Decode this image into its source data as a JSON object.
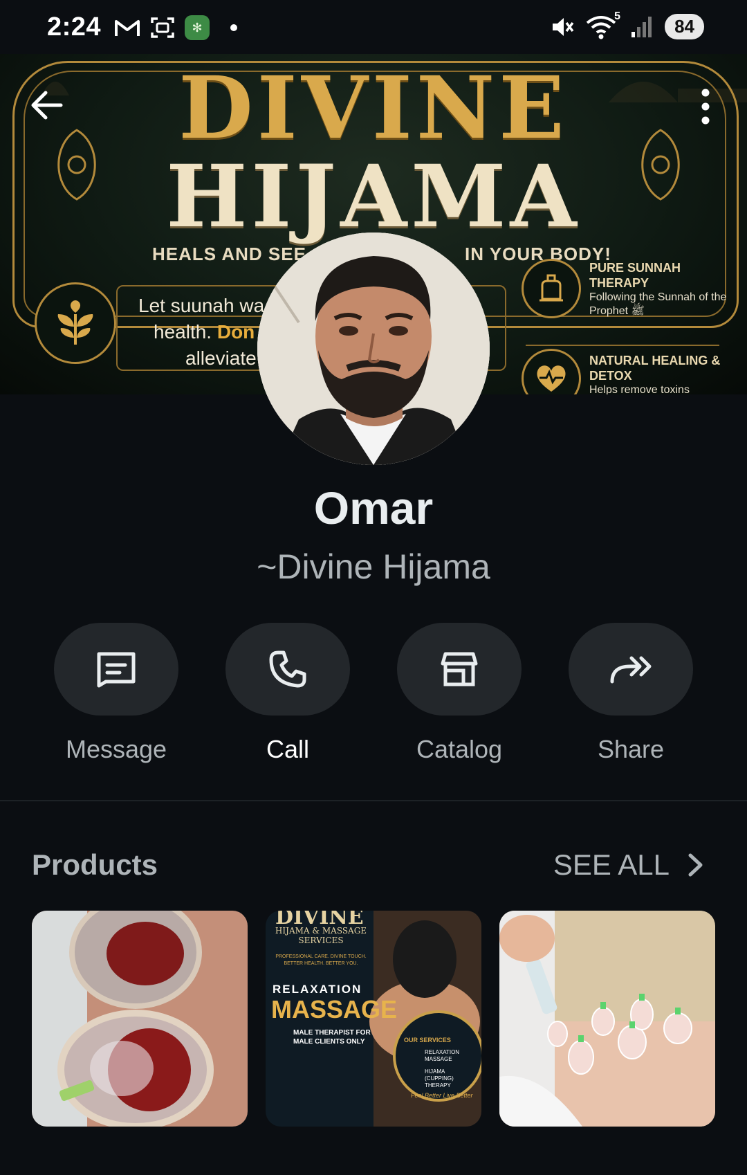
{
  "status_bar": {
    "time": "2:24",
    "battery": "84",
    "network_badge": "5",
    "icons": [
      "gmail-icon",
      "screenshot-icon",
      "quran-app-icon",
      "notification-dot",
      "mute-icon",
      "wifi-icon",
      "signal-icon",
      "battery-icon"
    ]
  },
  "cover": {
    "title_line1": "DIVINE",
    "title_line2": "HIJAMA",
    "tagline_left": "HEALS AND SEE",
    "tagline_right": "IN YOUR BODY!",
    "promo_line1": "Let suunah wa",
    "promo_line2_plain": "health. ",
    "promo_line2_bold": "Don",
    "promo_line3": "alleviate",
    "feature1_title": "PURE SUNNAH THERAPY",
    "feature1_desc": "Following the Sunnah of the Prophet ﷺ",
    "feature2_title": "NATURAL HEALING & DETOX",
    "feature2_desc": "Helps remove toxins"
  },
  "profile": {
    "name": "Omar",
    "subtitle": "~Divine Hijama"
  },
  "actions": [
    {
      "label": "Message",
      "icon": "message-icon"
    },
    {
      "label": "Call",
      "icon": "phone-icon"
    },
    {
      "label": "Catalog",
      "icon": "storefront-icon"
    },
    {
      "label": "Share",
      "icon": "share-forward-icon"
    }
  ],
  "products": {
    "title": "Products",
    "see_all": "SEE ALL",
    "items": [
      {
        "name": "cupping-closeup"
      },
      {
        "name": "massage-flyer",
        "flyer_title": "DIVINE",
        "flyer_subtitle": "HIJAMA & MASSAGE SERVICES",
        "flyer_tagline": "PROFESSIONAL CARE. DIVINE TOUCH. BETTER HEALTH. BETTER YOU.",
        "flyer_heading1": "RELAXATION",
        "flyer_heading2": "MASSAGE",
        "flyer_badge": "MALE THERAPIST FOR MALE CLIENTS ONLY",
        "flyer_services": "OUR SERVICES",
        "flyer_service1": "RELAXATION MASSAGE",
        "flyer_service2": "HIJAMA (CUPPING) THERAPY",
        "flyer_footer": "Feel Better Live Better"
      },
      {
        "name": "cupping-back-treatment"
      }
    ]
  },
  "colors": {
    "background": "#0b0e12",
    "pill": "#23272b",
    "gold": "#d9a94c",
    "muted_text": "#aeb4b8"
  }
}
